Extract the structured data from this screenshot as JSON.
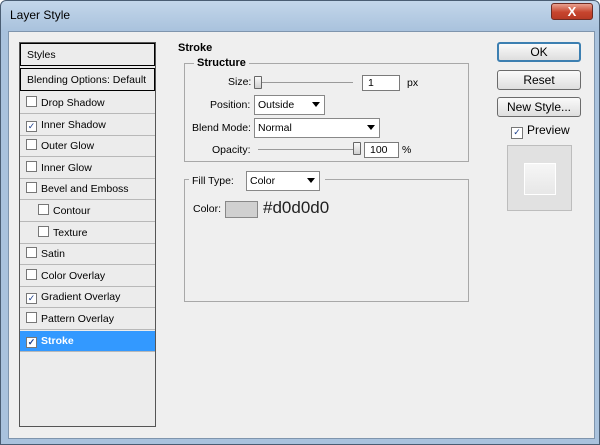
{
  "window": {
    "title": "Layer Style",
    "close_glyph": "X"
  },
  "styles_panel": {
    "header": "Styles",
    "blending": "Blending Options: Default",
    "items": [
      {
        "label": "Drop Shadow",
        "checked": false,
        "indent": false
      },
      {
        "label": "Inner Shadow",
        "checked": true,
        "indent": false
      },
      {
        "label": "Outer Glow",
        "checked": false,
        "indent": false
      },
      {
        "label": "Inner Glow",
        "checked": false,
        "indent": false
      },
      {
        "label": "Bevel and Emboss",
        "checked": false,
        "indent": false
      },
      {
        "label": "Contour",
        "checked": false,
        "indent": true
      },
      {
        "label": "Texture",
        "checked": false,
        "indent": true
      },
      {
        "label": "Satin",
        "checked": false,
        "indent": false
      },
      {
        "label": "Color Overlay",
        "checked": false,
        "indent": false
      },
      {
        "label": "Gradient Overlay",
        "checked": true,
        "indent": false
      },
      {
        "label": "Pattern Overlay",
        "checked": false,
        "indent": false
      },
      {
        "label": "Stroke",
        "checked": true,
        "indent": false,
        "selected": true
      }
    ]
  },
  "stroke": {
    "section_title": "Stroke",
    "structure_title": "Structure",
    "size_label": "Size:",
    "size_value": "1",
    "size_unit": "px",
    "position_label": "Position:",
    "position_value": "Outside",
    "blend_label": "Blend Mode:",
    "blend_value": "Normal",
    "opacity_label": "Opacity:",
    "opacity_value": "100",
    "opacity_unit": "%",
    "fill_type_label": "Fill Type:",
    "fill_type_value": "Color",
    "color_label": "Color:",
    "color_hex": "#d0d0d0",
    "swatch_color": "#d0d0d0"
  },
  "buttons": {
    "ok": "OK",
    "reset": "Reset",
    "new_style": "New Style...",
    "preview": "Preview",
    "preview_checked": true
  },
  "checkmark": "✓"
}
